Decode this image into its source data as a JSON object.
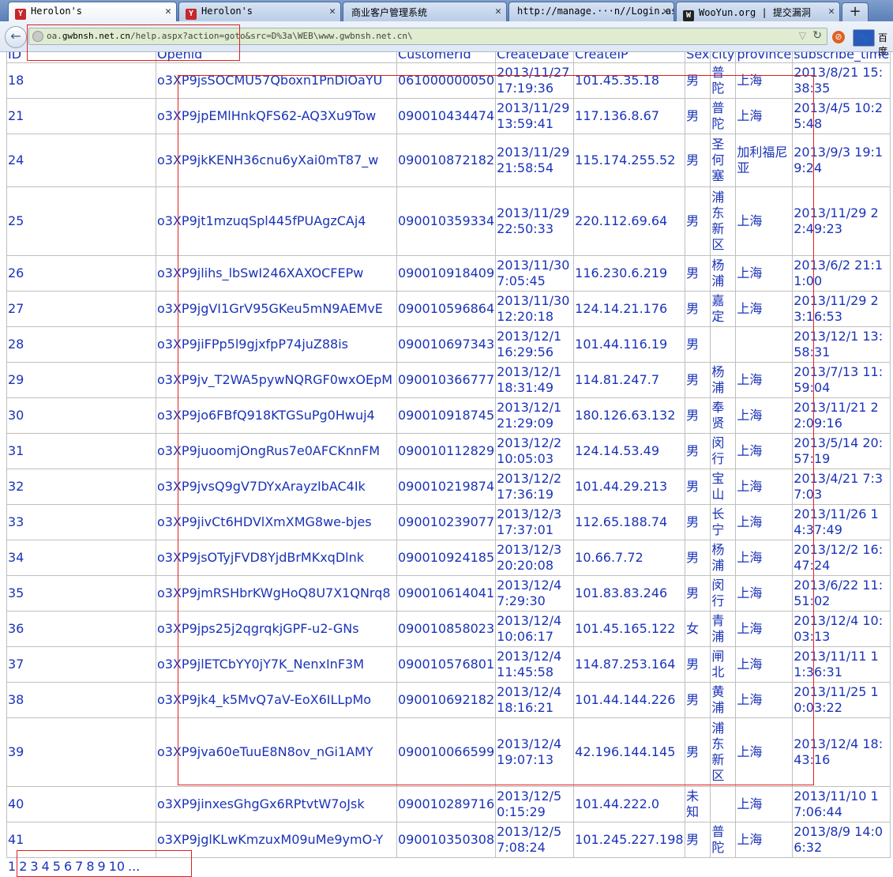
{
  "browser": {
    "tabs": [
      {
        "title": "Herolon's",
        "icon": "Y",
        "active": true
      },
      {
        "title": "Herolon's",
        "icon": "Y",
        "active": false
      },
      {
        "title": "商业客户管理系统",
        "icon": "",
        "active": false
      },
      {
        "title": "http://manage.···n//Login.aspx",
        "icon": "",
        "active": false
      },
      {
        "title": "WooYun.org | 提交漏洞",
        "icon": "W",
        "active": false
      }
    ],
    "url_prefix": "oa.",
    "url_host": "gwbnsh.net.cn",
    "url_path": "/help.aspx?action=goto&src=D%3a\\WEB\\www.gwbnsh.net.cn\\",
    "search_label": "百度"
  },
  "table": {
    "headers": [
      "ID",
      "Openid",
      "CustomerId",
      "CreateDate",
      "CreateIP",
      "Sex",
      "city",
      "province",
      "subscribe_time"
    ],
    "rows": [
      {
        "id": "18",
        "openid": "o3XP9jsSOCMU57Qboxn1PnDiOaYU",
        "customer": "061000000050",
        "date": "2013/11/27 17:19:36",
        "ip": "101.45.35.18",
        "sex": "男",
        "city": "普陀",
        "province": "上海",
        "sub": "2013/8/21 15:38:35"
      },
      {
        "id": "21",
        "openid": "o3XP9jpEMlHnkQFS62-AQ3Xu9Tow",
        "customer": "090010434474",
        "date": "2013/11/29 13:59:41",
        "ip": "117.136.8.67",
        "sex": "男",
        "city": "普陀",
        "province": "上海",
        "sub": "2013/4/5 10:25:48"
      },
      {
        "id": "24",
        "openid": "o3XP9jkKENH36cnu6yXai0mT87_w",
        "customer": "090010872182",
        "date": "2013/11/29 21:58:54",
        "ip": "115.174.255.52",
        "sex": "男",
        "city": "圣何塞",
        "province": "加利福尼亚",
        "sub": "2013/9/3 19:19:24"
      },
      {
        "id": "25",
        "openid": "o3XP9jt1mzuqSpl445fPUAgzCAj4",
        "customer": "090010359334",
        "date": "2013/11/29 22:50:33",
        "ip": "220.112.69.64",
        "sex": "男",
        "city": "浦东新区",
        "province": "上海",
        "sub": "2013/11/29 22:49:23"
      },
      {
        "id": "26",
        "openid": "o3XP9jlihs_lbSwI246XAXOCFEPw",
        "customer": "090010918409",
        "date": "2013/11/30 7:05:45",
        "ip": "116.230.6.219",
        "sex": "男",
        "city": "杨浦",
        "province": "上海",
        "sub": "2013/6/2 21:11:00"
      },
      {
        "id": "27",
        "openid": "o3XP9jgVI1GrV95GKeu5mN9AEMvE",
        "customer": "090010596864",
        "date": "2013/11/30 12:20:18",
        "ip": "124.14.21.176",
        "sex": "男",
        "city": "嘉定",
        "province": "上海",
        "sub": "2013/11/29 23:16:53"
      },
      {
        "id": "28",
        "openid": "o3XP9jiFPp5l9gjxfpP74juZ88is",
        "customer": "090010697343",
        "date": "2013/12/1 16:29:56",
        "ip": "101.44.116.19",
        "sex": "男",
        "city": "",
        "province": "",
        "sub": "2013/12/1 13:58:31"
      },
      {
        "id": "29",
        "openid": "o3XP9jv_T2WA5pywNQRGF0wxOEpM",
        "customer": "090010366777",
        "date": "2013/12/1 18:31:49",
        "ip": "114.81.247.7",
        "sex": "男",
        "city": "杨浦",
        "province": "上海",
        "sub": "2013/7/13 11:59:04"
      },
      {
        "id": "30",
        "openid": "o3XP9jo6FBfQ918KTGSuPg0Hwuj4",
        "customer": "090010918745",
        "date": "2013/12/1 21:29:09",
        "ip": "180.126.63.132",
        "sex": "男",
        "city": "奉贤",
        "province": "上海",
        "sub": "2013/11/21 22:09:16"
      },
      {
        "id": "31",
        "openid": "o3XP9juoomjOngRus7e0AFCKnnFM",
        "customer": "090010112829",
        "date": "2013/12/2 10:05:03",
        "ip": "124.14.53.49",
        "sex": "男",
        "city": "闵行",
        "province": "上海",
        "sub": "2013/5/14 20:57:19"
      },
      {
        "id": "32",
        "openid": "o3XP9jvsQ9gV7DYxArayzIbAC4Ik",
        "customer": "090010219874",
        "date": "2013/12/2 17:36:19",
        "ip": "101.44.29.213",
        "sex": "男",
        "city": "宝山",
        "province": "上海",
        "sub": "2013/4/21 7:37:03"
      },
      {
        "id": "33",
        "openid": "o3XP9jivCt6HDVlXmXMG8we-bjes",
        "customer": "090010239077",
        "date": "2013/12/3 17:37:01",
        "ip": "112.65.188.74",
        "sex": "男",
        "city": "长宁",
        "province": "上海",
        "sub": "2013/11/26 14:37:49"
      },
      {
        "id": "34",
        "openid": "o3XP9jsOTyjFVD8YjdBrMKxqDlnk",
        "customer": "090010924185",
        "date": "2013/12/3 20:20:08",
        "ip": "10.66.7.72",
        "sex": "男",
        "city": "杨浦",
        "province": "上海",
        "sub": "2013/12/2 16:47:24"
      },
      {
        "id": "35",
        "openid": "o3XP9jmRSHbrKWgHoQ8U7X1QNrq8",
        "customer": "090010614041",
        "date": "2013/12/4 7:29:30",
        "ip": "101.83.83.246",
        "sex": "男",
        "city": "闵行",
        "province": "上海",
        "sub": "2013/6/22 11:51:02"
      },
      {
        "id": "36",
        "openid": "o3XP9jps25j2qgrqkjGPF-u2-GNs",
        "customer": "090010858023",
        "date": "2013/12/4 10:06:17",
        "ip": "101.45.165.122",
        "sex": "女",
        "city": "青浦",
        "province": "上海",
        "sub": "2013/12/4 10:03:13"
      },
      {
        "id": "37",
        "openid": "o3XP9jlETCbYY0jY7K_NenxInF3M",
        "customer": "090010576801",
        "date": "2013/12/4 11:45:58",
        "ip": "114.87.253.164",
        "sex": "男",
        "city": "闸北",
        "province": "上海",
        "sub": "2013/11/11 11:36:31"
      },
      {
        "id": "38",
        "openid": "o3XP9jk4_k5MvQ7aV-EoX6ILLpMo",
        "customer": "090010692182",
        "date": "2013/12/4 18:16:21",
        "ip": "101.44.144.226",
        "sex": "男",
        "city": "黄浦",
        "province": "上海",
        "sub": "2013/11/25 10:03:22"
      },
      {
        "id": "39",
        "openid": "o3XP9jva60eTuuE8N8ov_nGi1AMY",
        "customer": "090010066599",
        "date": "2013/12/4 19:07:13",
        "ip": "42.196.144.145",
        "sex": "男",
        "city": "浦东新区",
        "province": "上海",
        "sub": "2013/12/4 18:43:16"
      },
      {
        "id": "40",
        "openid": "o3XP9jinxesGhgGx6RPtvtW7oJsk",
        "customer": "090010289716",
        "date": "2013/12/5 0:15:29",
        "ip": "101.44.222.0",
        "sex": "未知",
        "city": "",
        "province": "上海",
        "sub": "2013/11/10 17:06:44"
      },
      {
        "id": "41",
        "openid": "o3XP9jglKLwKmzuxM09uMe9ymO-Y",
        "customer": "090010350308",
        "date": "2013/12/5 7:08:24",
        "ip": "101.245.227.198",
        "sex": "男",
        "city": "普陀",
        "province": "上海",
        "sub": "2013/8/9 14:06:32"
      }
    ]
  },
  "pager": {
    "current": "1",
    "pages": [
      "2",
      "3",
      "4",
      "5",
      "6",
      "7",
      "8",
      "9",
      "10",
      "..."
    ]
  },
  "colors": {
    "link": "#1a33b8",
    "highlight": "#e02020"
  }
}
